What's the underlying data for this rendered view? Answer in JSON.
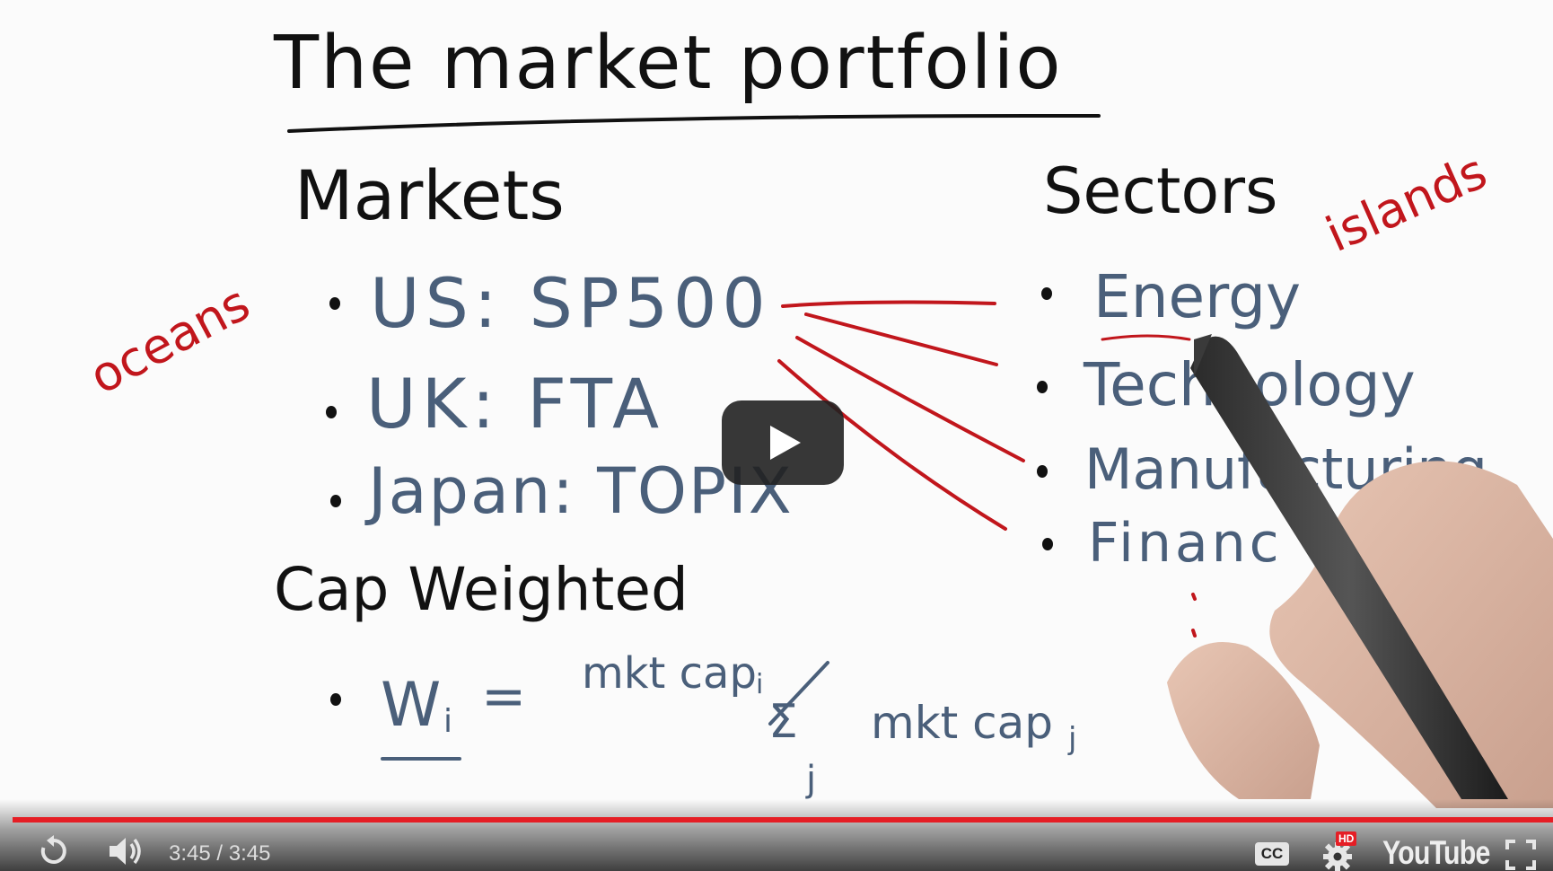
{
  "video": {
    "title": "The market portfolio",
    "markets_heading": "Markets",
    "markets": [
      {
        "label": "US: SP500"
      },
      {
        "label": "UK: FTA"
      },
      {
        "label": "Japan: TOPIX"
      }
    ],
    "sectors_heading": "Sectors",
    "sectors": [
      {
        "label": "Energy"
      },
      {
        "label": "Technology"
      },
      {
        "label": "Manufacturing"
      },
      {
        "label": "Financ"
      }
    ],
    "note_oceans": "oceans",
    "note_islands": "islands",
    "cap_heading": "Cap Weighted",
    "formula": {
      "lhs": "W",
      "lhs_sub": "i",
      "equals": "=",
      "numerator": "mkt cap",
      "numerator_sub": "i",
      "slash": "/",
      "sigma": "Σ",
      "sigma_sub": "j",
      "denominator": "mkt cap",
      "denominator_sub": "j"
    },
    "colors": {
      "ink_black": "#111111",
      "ink_blue": "#4a5f7a",
      "ink_red": "#c1161c"
    }
  },
  "player": {
    "progress": 1.0,
    "current_time": "3:45",
    "duration": "3:45",
    "time_separator": " / ",
    "replay_icon": "replay-icon",
    "volume_icon": "volume-icon",
    "cc_icon": "cc-icon",
    "settings_icon": "settings-gear-icon",
    "hd_badge": "HD",
    "cc_label": "CC",
    "logo_text": "YouTube",
    "fullscreen_icon": "fullscreen-icon",
    "accent_color": "#e51e25"
  }
}
